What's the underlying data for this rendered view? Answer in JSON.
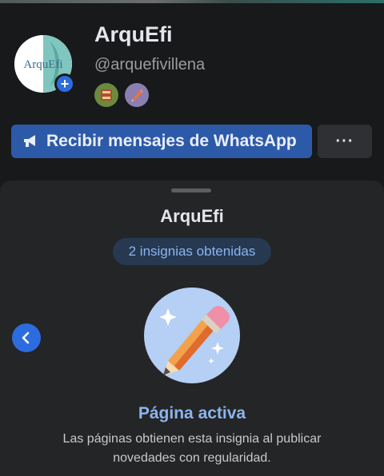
{
  "profile": {
    "name": "ArquEfi",
    "handle": "@arquefivillena",
    "avatar_text": "ArquEfi",
    "add_symbol": "+",
    "badges": [
      {
        "icon": "book-badge-icon",
        "color": "#6c8a3d"
      },
      {
        "icon": "pencil-badge-icon",
        "color": "#8a7fb0"
      }
    ]
  },
  "actions": {
    "whatsapp_label": "Recibir mensajes de WhatsApp",
    "whatsapp_icon": "megaphone-icon",
    "more_label": "···"
  },
  "sheet": {
    "title": "ArquEfi",
    "badge_count": "2 insignias obtenidas",
    "prev_icon": "chevron-left-icon",
    "badge": {
      "icon": "pencil-sparkle-icon",
      "title": "Página activa",
      "description": "Las páginas obtienen esta insignia al publicar novedades con regularidad."
    }
  },
  "colors": {
    "background": "#18191a",
    "sheet": "#242526",
    "primary_button": "#2d5aa8",
    "accent_blue": "#2d6cdf",
    "badge_title": "#8cb4f0",
    "badge_circle": "#b5cff5"
  }
}
